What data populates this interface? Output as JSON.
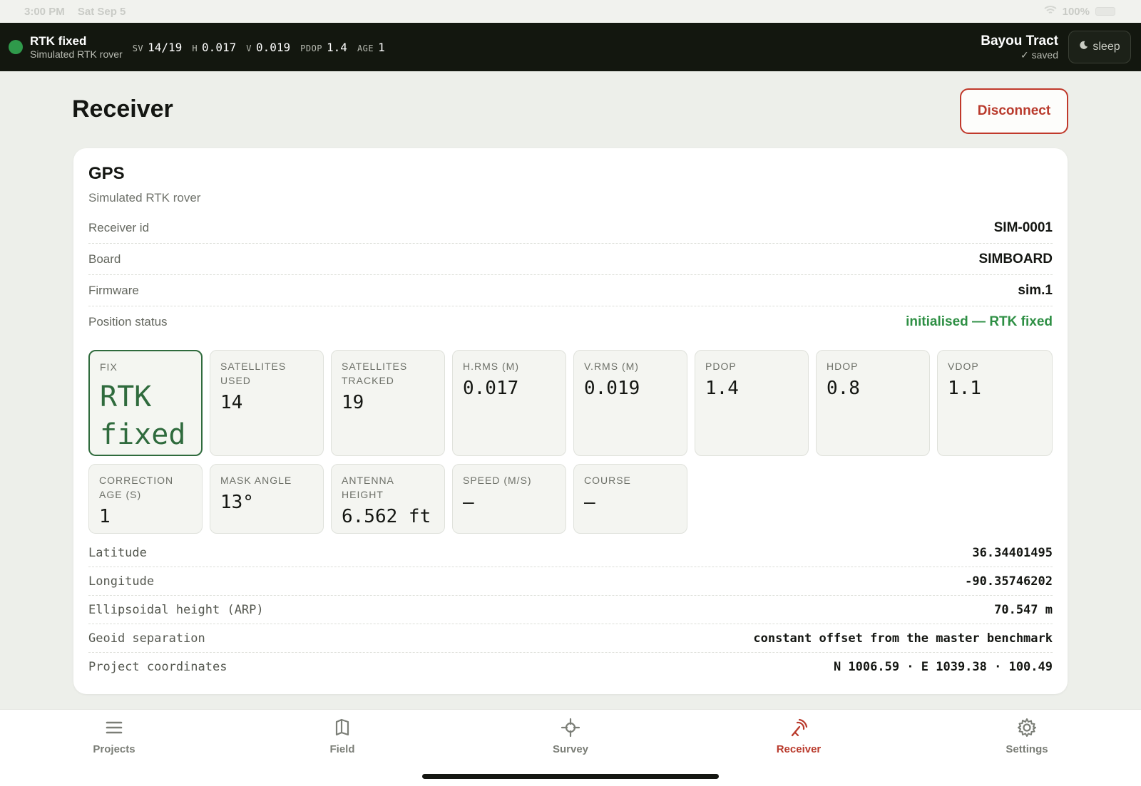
{
  "ios_status": {
    "time": "3:00 PM",
    "date": "Sat Sep 5",
    "battery": "100%"
  },
  "topbar": {
    "fix_title": "RTK fixed",
    "fix_subtitle": "Simulated RTK rover",
    "metrics": [
      {
        "key": "SV",
        "value": "14/19"
      },
      {
        "key": "H",
        "value": "0.017"
      },
      {
        "key": "V",
        "value": "0.019"
      },
      {
        "key": "PDOP",
        "value": "1.4"
      },
      {
        "key": "AGE",
        "value": "1"
      }
    ],
    "project_name": "Bayou Tract",
    "project_saved": "✓ saved",
    "sleep_label": "sleep"
  },
  "page": {
    "title": "Receiver",
    "disconnect_label": "Disconnect"
  },
  "card": {
    "title": "GPS",
    "subtitle": "Simulated RTK rover",
    "info_rows": [
      {
        "label": "Receiver id",
        "value": "SIM-0001"
      },
      {
        "label": "Board",
        "value": "SIMBOARD"
      },
      {
        "label": "Firmware",
        "value": "sim.1"
      },
      {
        "label": "Position status",
        "value": "initialised — RTK fixed"
      }
    ],
    "tiles": [
      {
        "label": "FIX",
        "value": "RTK fixed"
      },
      {
        "label": "SATELLITES USED",
        "value": "14"
      },
      {
        "label": "SATELLITES TRACKED",
        "value": "19"
      },
      {
        "label": "H.RMS (M)",
        "value": "0.017"
      },
      {
        "label": "V.RMS (M)",
        "value": "0.019"
      },
      {
        "label": "PDOP",
        "value": "1.4"
      },
      {
        "label": "HDOP",
        "value": "0.8"
      },
      {
        "label": "VDOP",
        "value": "1.1"
      },
      {
        "label": "CORRECTION AGE (S)",
        "value": "1"
      },
      {
        "label": "MASK ANGLE",
        "value": "13°"
      },
      {
        "label": "ANTENNA HEIGHT",
        "value": "6.562 ft"
      },
      {
        "label": "SPEED (M/S)",
        "value": "—"
      },
      {
        "label": "COURSE",
        "value": "—"
      }
    ],
    "coord_rows": [
      {
        "label": "Latitude",
        "value": "36.34401495"
      },
      {
        "label": "Longitude",
        "value": "-90.35746202"
      },
      {
        "label": "Ellipsoidal height (ARP)",
        "value": "70.547 m"
      },
      {
        "label": "Geoid separation",
        "value": "constant offset from the master benchmark"
      },
      {
        "label": "Project coordinates",
        "value": "N 1006.59 · E 1039.38 · 100.49"
      }
    ]
  },
  "tabbar": {
    "items": [
      {
        "label": "Projects",
        "icon": "list-icon"
      },
      {
        "label": "Field",
        "icon": "map-icon"
      },
      {
        "label": "Survey",
        "icon": "crosshair-icon"
      },
      {
        "label": "Receiver",
        "icon": "antenna-icon",
        "active": true
      },
      {
        "label": "Settings",
        "icon": "gear-icon"
      }
    ]
  },
  "colors": {
    "accent": "#b93a2c",
    "fix_green": "#2f9a4b",
    "topbar_bg": "#13170f"
  }
}
